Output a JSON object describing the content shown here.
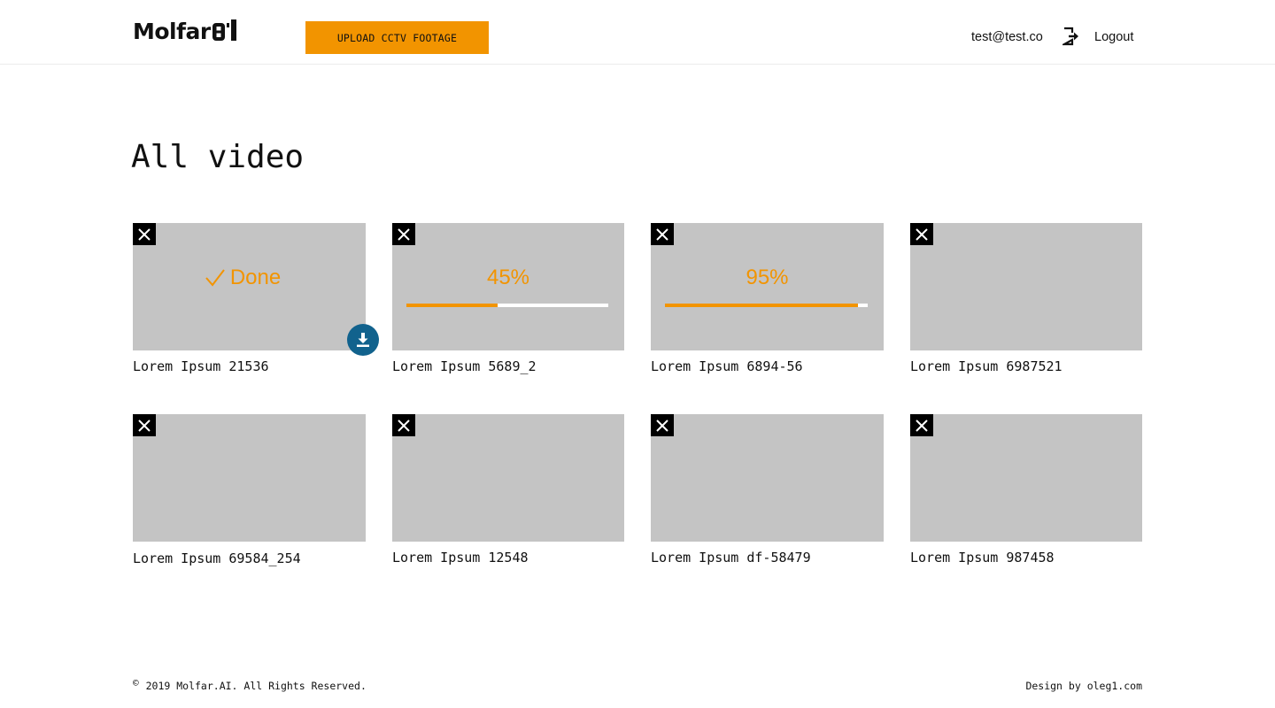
{
  "header": {
    "logo_text": "Molfar",
    "logo_suffix": "AI",
    "upload_label": "UPLOAD CCTV FOOTAGE",
    "user_email": "test@test.co",
    "logout_label": "Logout"
  },
  "main": {
    "title": "All video",
    "videos": [
      {
        "title": "Lorem Ipsum 21536",
        "status": "done",
        "status_label": "Done"
      },
      {
        "title": "Lorem Ipsum 5689_2",
        "status": "uploading",
        "progress_label": "45%",
        "progress": 0.45
      },
      {
        "title": "Lorem Ipsum 6894-56",
        "status": "uploading",
        "progress_label": "95%",
        "progress": 0.95
      },
      {
        "title": "Lorem Ipsum 6987521",
        "status": "idle"
      },
      {
        "title": "Lorem Ipsum 69584_254",
        "status": "idle"
      },
      {
        "title": "Lorem Ipsum 12548",
        "status": "idle"
      },
      {
        "title": "Lorem Ipsum df-58479",
        "status": "idle"
      },
      {
        "title": "Lorem Ipsum 987458",
        "status": "idle"
      }
    ]
  },
  "footer": {
    "copyright_symbol": "©",
    "copyright": "2019 Molfar.AI. All Rights Reserved.",
    "design_prefix": "Design by",
    "design_link": "oleg1.com"
  },
  "colors": {
    "accent": "#f29400",
    "thumbnail": "#c4c4c4",
    "download": "#11628d"
  },
  "icons": [
    "logout-icon",
    "close-icon",
    "check-icon",
    "download-icon"
  ]
}
